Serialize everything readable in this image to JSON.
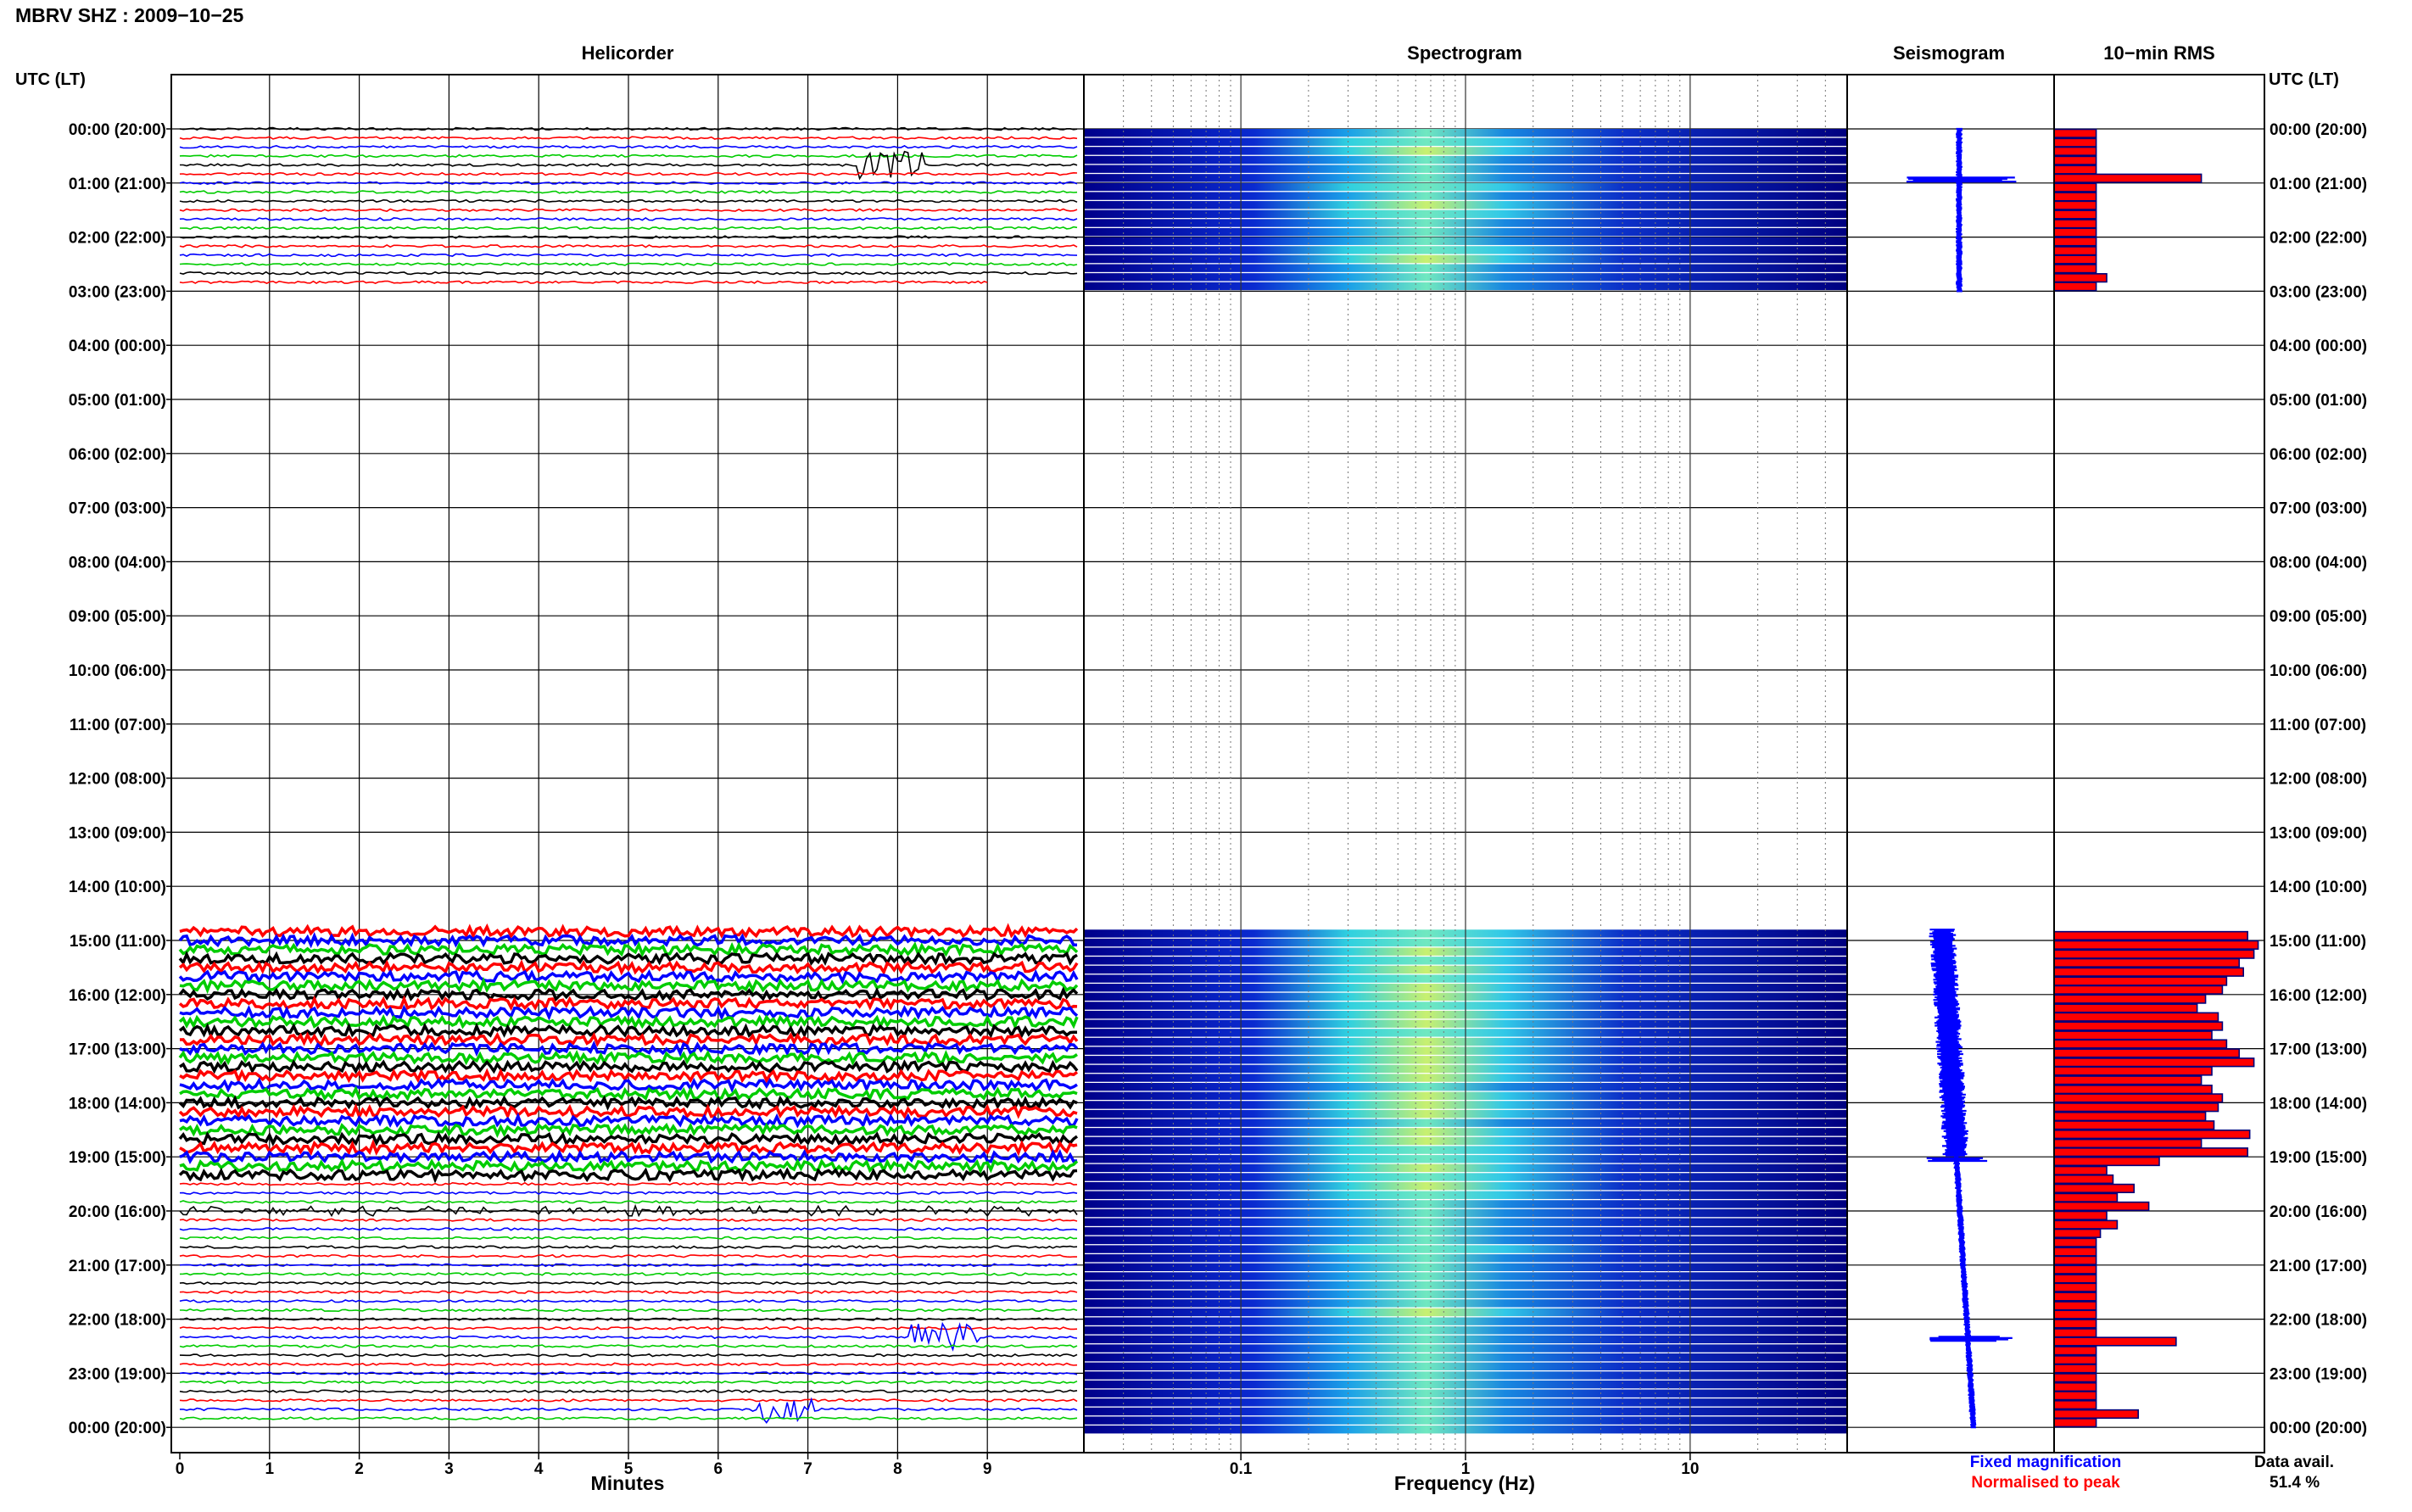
{
  "header": {
    "title": "MBRV SHZ : 2009−10−25",
    "time_axis_label_left": "UTC (LT)",
    "time_axis_label_right": "UTC (LT)"
  },
  "panels": {
    "helicorder": "Helicorder",
    "spectrogram": "Spectrogram",
    "seismogram": "Seismogram",
    "rms": "10−min RMS"
  },
  "time_labels": [
    "00:00 (20:00)",
    "01:00 (21:00)",
    "02:00 (22:00)",
    "03:00 (23:00)",
    "04:00 (00:00)",
    "05:00 (01:00)",
    "06:00 (02:00)",
    "07:00 (03:00)",
    "08:00 (04:00)",
    "09:00 (05:00)",
    "10:00 (06:00)",
    "11:00 (07:00)",
    "12:00 (08:00)",
    "13:00 (09:00)",
    "14:00 (10:00)",
    "15:00 (11:00)",
    "16:00 (12:00)",
    "17:00 (13:00)",
    "18:00 (14:00)",
    "19:00 (15:00)",
    "20:00 (16:00)",
    "21:00 (17:00)",
    "22:00 (18:00)",
    "23:00 (19:00)",
    "00:00 (20:00)"
  ],
  "footer": {
    "minutes_label": "Minutes",
    "frequency_label": "Frequency (Hz)",
    "legend_fixed": "Fixed magnification",
    "legend_normalised": "Normalised to peak",
    "data_avail_label": "Data avail.",
    "data_avail_value": "51.4 %"
  },
  "colors": {
    "trace_cycle": [
      "#000000",
      "#ff0000",
      "#0000ff",
      "#00cc00"
    ],
    "fixed_magnification": "#0000ff",
    "normalised_to_peak": "#ff0000",
    "rms_fill": "#ff0000",
    "rms_edge": "#00007a",
    "spectrogram_background": "#000090"
  },
  "chart_data": [
    {
      "type": "line",
      "name": "helicorder",
      "xlabel": "Minutes",
      "x_ticks": [
        "0",
        "1",
        "2",
        "3",
        "4",
        "5",
        "6",
        "7",
        "8",
        "9"
      ],
      "xlim": [
        0,
        10
      ],
      "rows_per_hour": 6,
      "data_windows_hours": [
        [
          0,
          3
        ],
        [
          14.8,
          24
        ]
      ],
      "events": [
        {
          "hour": 0.7,
          "minute": 7.7,
          "color": "red"
        },
        {
          "hour": 22.3,
          "minute": 8.3,
          "color": "blue"
        },
        {
          "hour": 23.7,
          "minute": 6.5,
          "color": "blue"
        }
      ]
    },
    {
      "type": "heatmap",
      "name": "spectrogram",
      "xlabel": "Frequency (Hz)",
      "x_scale": "log",
      "xlim": [
        0.02,
        50
      ],
      "x_ticks": [
        "0.1",
        "1",
        "10"
      ],
      "peak_band_hz": [
        0.3,
        1.5
      ],
      "data_windows_hours": [
        [
          0,
          3
        ],
        [
          14.8,
          24
        ]
      ]
    },
    {
      "type": "line",
      "name": "seismogram",
      "data_windows_hours": [
        [
          0,
          3
        ],
        [
          14.8,
          24
        ]
      ]
    },
    {
      "type": "bar",
      "name": "10-min RMS",
      "hours": [
        0.0,
        0.17,
        0.33,
        0.5,
        0.67,
        0.83,
        1.0,
        1.17,
        1.33,
        1.5,
        1.67,
        1.83,
        2.0,
        2.17,
        2.33,
        2.5,
        2.67,
        2.83,
        14.83,
        15.0,
        15.17,
        15.33,
        15.5,
        15.67,
        15.83,
        16.0,
        16.17,
        16.33,
        16.5,
        16.67,
        16.83,
        17.0,
        17.17,
        17.33,
        17.5,
        17.67,
        17.83,
        18.0,
        18.17,
        18.33,
        18.5,
        18.67,
        18.83,
        19.0,
        19.17,
        19.33,
        19.5,
        19.67,
        19.83,
        20.0,
        20.17,
        20.33,
        20.5,
        20.67,
        20.83,
        21.0,
        21.17,
        21.33,
        21.5,
        21.67,
        21.83,
        22.0,
        22.17,
        22.33,
        22.5,
        22.67,
        22.83,
        23.0,
        23.17,
        23.33,
        23.5,
        23.67,
        23.83
      ],
      "values": [
        0.2,
        0.2,
        0.2,
        0.2,
        0.2,
        0.7,
        0.2,
        0.2,
        0.2,
        0.2,
        0.2,
        0.2,
        0.2,
        0.2,
        0.2,
        0.2,
        0.25,
        0.2,
        0.92,
        0.97,
        0.95,
        0.88,
        0.9,
        0.82,
        0.8,
        0.72,
        0.68,
        0.78,
        0.8,
        0.75,
        0.82,
        0.88,
        0.95,
        0.75,
        0.7,
        0.75,
        0.8,
        0.78,
        0.72,
        0.76,
        0.93,
        0.7,
        0.92,
        0.5,
        0.25,
        0.28,
        0.38,
        0.3,
        0.45,
        0.25,
        0.3,
        0.22,
        0.2,
        0.2,
        0.2,
        0.2,
        0.2,
        0.2,
        0.2,
        0.2,
        0.2,
        0.2,
        0.2,
        0.58,
        0.2,
        0.2,
        0.2,
        0.2,
        0.2,
        0.2,
        0.2,
        0.4,
        0.2
      ],
      "xlim": [
        0,
        1
      ]
    }
  ]
}
